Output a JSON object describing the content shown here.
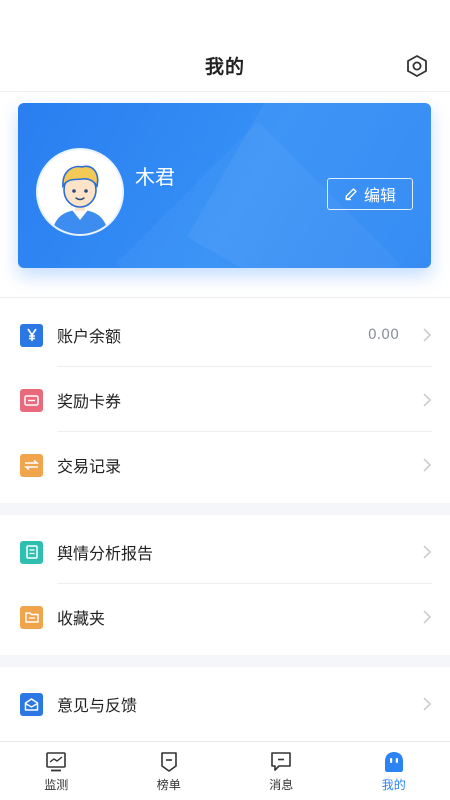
{
  "header": {
    "title": "我的",
    "settings_icon": "hexagon-settings-icon"
  },
  "profile": {
    "username": "木君",
    "edit_label": "编辑",
    "edit_icon": "pencil-icon",
    "card_color": "#2c86f3"
  },
  "menu": {
    "balance": {
      "label": "账户余额",
      "value": "0.00",
      "icon": "yen-icon",
      "color": "#2b78e4"
    },
    "coupons": {
      "label": "奖励卡券",
      "icon": "ticket-icon",
      "color": "#e96a7c"
    },
    "transactions": {
      "label": "交易记录",
      "icon": "exchange-icon",
      "color": "#f0a54d"
    },
    "reports": {
      "label": "舆情分析报告",
      "icon": "document-icon",
      "color": "#2fbfb0"
    },
    "favorites": {
      "label": "收藏夹",
      "icon": "folder-icon",
      "color": "#f0a54d"
    },
    "feedback": {
      "label": "意见与反馈",
      "icon": "envelope-icon",
      "color": "#2b78e4"
    }
  },
  "tabbar": {
    "tabs": [
      {
        "label": "监测",
        "icon": "monitor-icon"
      },
      {
        "label": "榜单",
        "icon": "ranking-icon"
      },
      {
        "label": "消息",
        "icon": "message-icon"
      },
      {
        "label": "我的",
        "icon": "profile-icon",
        "active": true
      }
    ],
    "active_color": "#2b84f2"
  }
}
